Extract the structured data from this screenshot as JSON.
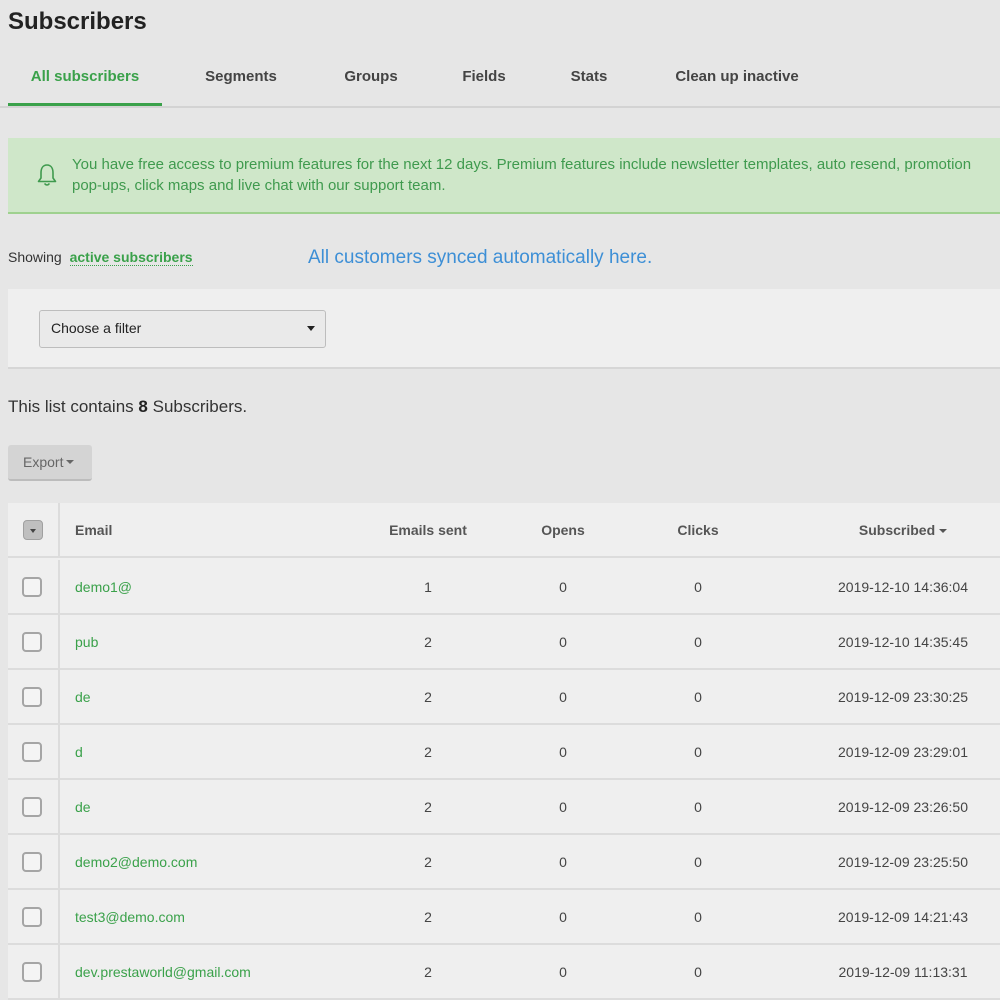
{
  "page": {
    "title": "Subscribers"
  },
  "tabs": [
    {
      "label": "All subscribers",
      "active": true
    },
    {
      "label": "Segments"
    },
    {
      "label": "Groups"
    },
    {
      "label": "Fields"
    },
    {
      "label": "Stats"
    },
    {
      "label": "Clean up inactive"
    }
  ],
  "notice": {
    "icon": "bell-icon",
    "text": "You have free access to premium features for the next 12 days. Premium features include newsletter templates, auto resend, promotion pop-ups, click maps and live chat with our support team."
  },
  "showing": {
    "prefix": "Showing",
    "link": "active subscribers"
  },
  "sync_note": "All customers synced automatically here.",
  "filter": {
    "selected": "Choose a filter"
  },
  "list_info": {
    "prefix": "This list contains",
    "count": "8",
    "suffix": "Subscribers."
  },
  "export": {
    "label": "Export"
  },
  "table": {
    "headers": {
      "email": "Email",
      "sent": "Emails sent",
      "opens": "Opens",
      "clicks": "Clicks",
      "subscribed": "Subscribed"
    },
    "rows": [
      {
        "email": "demo1@",
        "sent": "1",
        "opens": "0",
        "clicks": "0",
        "subscribed": "2019-12-10 14:36:04"
      },
      {
        "email": "pub",
        "sent": "2",
        "opens": "0",
        "clicks": "0",
        "subscribed": "2019-12-10 14:35:45"
      },
      {
        "email": "de",
        "sent": "2",
        "opens": "0",
        "clicks": "0",
        "subscribed": "2019-12-09 23:30:25"
      },
      {
        "email": "d",
        "sent": "2",
        "opens": "0",
        "clicks": "0",
        "subscribed": "2019-12-09 23:29:01"
      },
      {
        "email": "de",
        "sent": "2",
        "opens": "0",
        "clicks": "0",
        "subscribed": "2019-12-09 23:26:50"
      },
      {
        "email": "demo2@demo.com",
        "sent": "2",
        "opens": "0",
        "clicks": "0",
        "subscribed": "2019-12-09 23:25:50"
      },
      {
        "email": "test3@demo.com",
        "sent": "2",
        "opens": "0",
        "clicks": "0",
        "subscribed": "2019-12-09 14:21:43"
      },
      {
        "email": "dev.prestaworld@gmail.com",
        "sent": "2",
        "opens": "0",
        "clicks": "0",
        "subscribed": "2019-12-09 11:13:31"
      }
    ]
  }
}
